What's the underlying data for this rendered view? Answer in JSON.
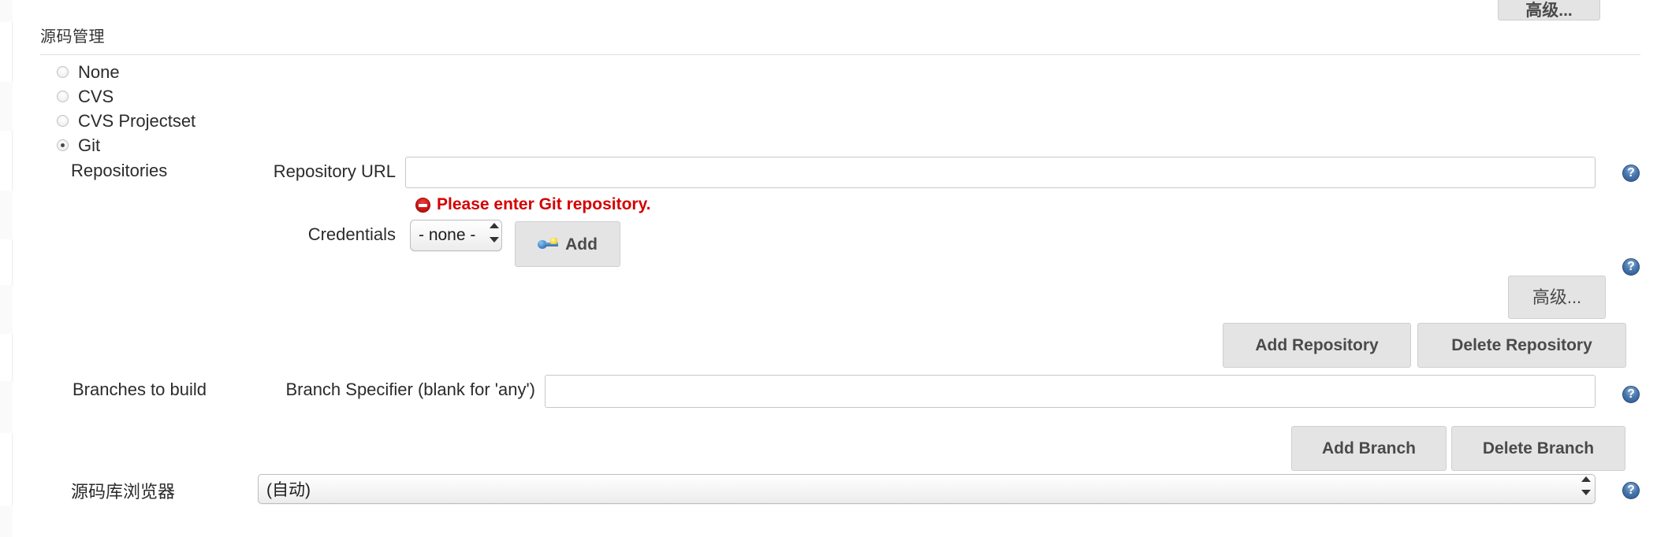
{
  "section": {
    "title": "源码管理"
  },
  "top_bar": {
    "advanced_label": "高级..."
  },
  "scm_options": [
    {
      "label": "None",
      "selected": false
    },
    {
      "label": "CVS",
      "selected": false
    },
    {
      "label": "CVS Projectset",
      "selected": false
    },
    {
      "label": "Git",
      "selected": true
    }
  ],
  "repositories": {
    "group_label": "Repositories",
    "repository_url": {
      "label": "Repository URL",
      "value": "",
      "placeholder": ""
    },
    "error": {
      "icon": "error-circle-icon",
      "message": "Please enter Git repository."
    },
    "credentials": {
      "label": "Credentials",
      "selected": "- none -",
      "options": [
        "- none -"
      ],
      "add_button_label": "Add",
      "add_button_icon": "key-icon"
    },
    "advanced_label": "高级...",
    "add_repository_label": "Add Repository",
    "delete_repository_label": "Delete Repository"
  },
  "branches": {
    "group_label": "Branches to build",
    "branch_specifier": {
      "label": "Branch Specifier (blank for 'any')",
      "value": "",
      "placeholder": ""
    },
    "add_branch_label": "Add Branch",
    "delete_branch_label": "Delete Branch"
  },
  "repository_browser": {
    "group_label": "源码库浏览器",
    "selected": "(自动)",
    "options": [
      "(自动)"
    ]
  },
  "help_icons": {
    "label": "?",
    "name": "help-icon"
  },
  "colors": {
    "error_red": "#d40000",
    "help_blue": "#2c548a",
    "button_face": "#e4e4e4",
    "text": "#2b2b2b"
  }
}
